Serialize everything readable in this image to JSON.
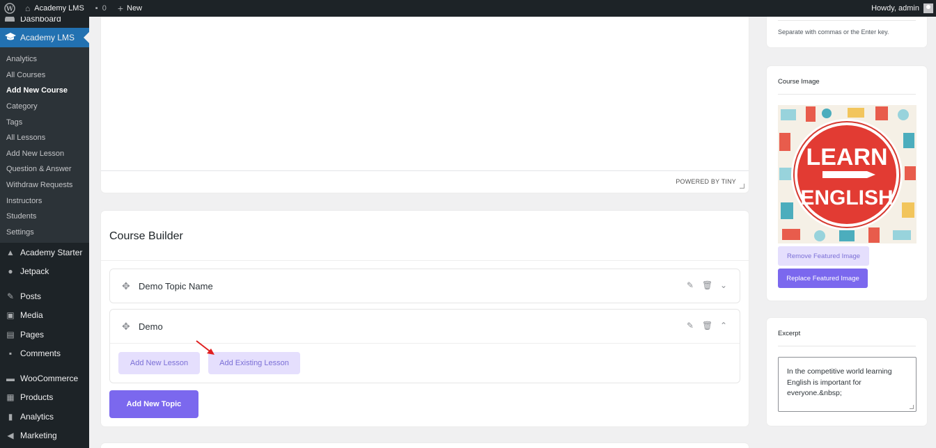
{
  "adminbar": {
    "site_name": "Academy LMS",
    "comments_count": "0",
    "new_label": "New",
    "greeting": "Howdy, admin"
  },
  "sidebar": {
    "partial_top_label": "Dashboard",
    "active_label": "Academy LMS",
    "submenu": [
      "Analytics",
      "All Courses",
      "Add New Course",
      "Category",
      "Tags",
      "All Lessons",
      "Add New Lesson",
      "Question & Answer",
      "Withdraw Requests",
      "Instructors",
      "Students",
      "Settings"
    ],
    "current_sub": "Add New Course",
    "menu_a": [
      "Academy Starter",
      "Jetpack"
    ],
    "menu_b": [
      "Posts",
      "Media",
      "Pages",
      "Comments"
    ],
    "menu_c": [
      "WooCommerce",
      "Products",
      "Analytics",
      "Marketing"
    ]
  },
  "editor": {
    "powered_by": "POWERED BY TINY"
  },
  "builder": {
    "title": "Course Builder",
    "topics": [
      {
        "name": "Demo Topic Name",
        "expanded": false
      },
      {
        "name": "Demo",
        "expanded": true
      }
    ],
    "add_new_lesson": "Add New Lesson",
    "add_existing_lesson": "Add Existing Lesson",
    "add_new_topic": "Add New Topic"
  },
  "tags": {
    "help_text": "Separate with commas or the Enter key."
  },
  "course_image": {
    "title": "Course Image",
    "image_text_line1": "LEARN",
    "image_text_line2": "ENGLISH",
    "remove_label": "Remove Featured Image",
    "replace_label": "Replace Featured Image"
  },
  "excerpt": {
    "title": "Excerpt",
    "value": "In the competitive world learning English is important for everyone.&nbsp;"
  },
  "colors": {
    "admin_dark": "#1d2327",
    "wp_blue": "#2271b1",
    "accent_purple": "#7b68ee",
    "soft_purple": "#e5dffd"
  }
}
